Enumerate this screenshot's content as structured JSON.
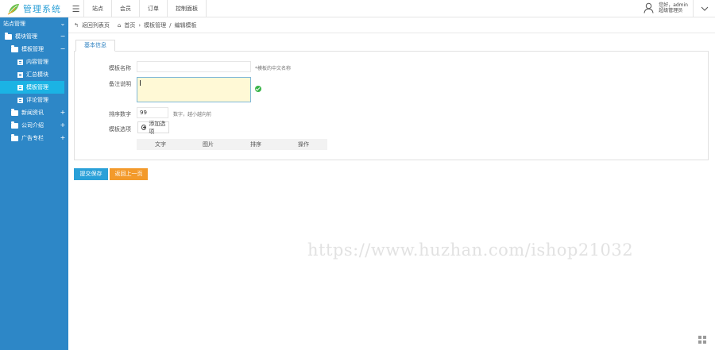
{
  "app": {
    "title": "管理系统"
  },
  "topnav": [
    "站点",
    "会员",
    "订单",
    "控制面板"
  ],
  "user": {
    "line1": "您好，admin",
    "line2": "超级管理员"
  },
  "sidebar": {
    "header": "站点管理",
    "items": [
      {
        "label": "模块管理",
        "toggle": "−"
      },
      {
        "label": "模板管理",
        "toggle": "−"
      },
      {
        "label": "内容管理"
      },
      {
        "label": "汇总模块"
      },
      {
        "label": "模板管理"
      },
      {
        "label": "评论管理"
      },
      {
        "label": "新闻资讯",
        "toggle": "+"
      },
      {
        "label": "公司介绍",
        "toggle": "+"
      },
      {
        "label": "广告专栏",
        "toggle": "+"
      }
    ]
  },
  "breadcrumb": {
    "back": "返回列表页",
    "home": "首页",
    "sep1": "›",
    "level1": "模板管理",
    "sep2": "/",
    "level2": "编辑模板"
  },
  "tab": {
    "label": "基本信息"
  },
  "form": {
    "name_label": "模板名称",
    "name_hint": "*模板的中文名称",
    "desc_label": "备注说明",
    "sort_label": "排序数字",
    "sort_value": "99",
    "sort_hint": "数字，越小越向前",
    "option_label": "模板选项",
    "add_option": "添加选项"
  },
  "option_table": {
    "headers": [
      "文字",
      "图片",
      "排序",
      "操作"
    ]
  },
  "actions": {
    "save": "提交保存",
    "back": "返回上一页"
  },
  "watermark": "https://www.huzhan.com/ishop21032",
  "colors": {
    "sidebar": "#2d87c7",
    "active": "#1bb3e4",
    "save": "#2aa0d8",
    "back": "#f39a2b"
  }
}
